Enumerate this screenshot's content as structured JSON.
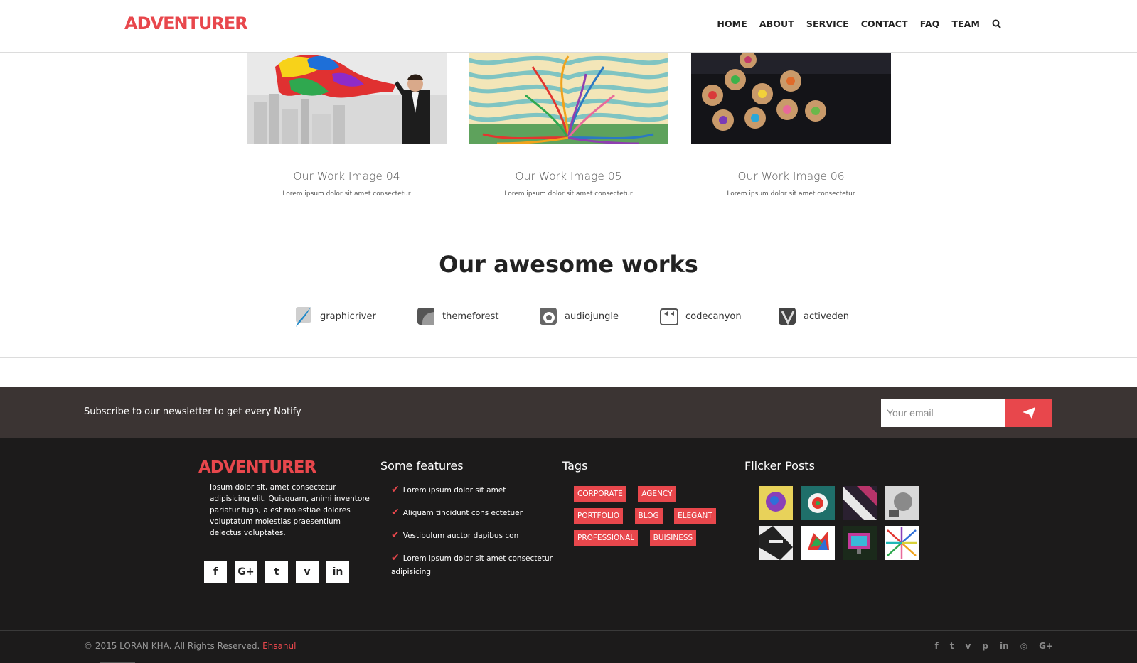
{
  "header": {
    "logo": "ADVENTURER",
    "nav": [
      "HOME",
      "ABOUT",
      "SERVICE",
      "CONTACT",
      "FAQ",
      "TEAM"
    ],
    "search_icon": "search-icon"
  },
  "works": [
    {
      "title": "Our Work Image 04",
      "desc": "Lorem ipsum dolor sit amet consectetur"
    },
    {
      "title": "Our Work Image 05",
      "desc": "Lorem ipsum dolor sit amet consectetur"
    },
    {
      "title": "Our Work Image 06",
      "desc": "Lorem ipsum dolor sit amet consectetur"
    }
  ],
  "awesome": {
    "title": "Our awesome works",
    "markets": [
      {
        "label": "graphicriver",
        "icon": "graphicriver-icon"
      },
      {
        "label": "themeforest",
        "icon": "themeforest-icon"
      },
      {
        "label": "audiojungle",
        "icon": "audiojungle-icon"
      },
      {
        "label": "codecanyon",
        "icon": "codecanyon-icon"
      },
      {
        "label": "activeden",
        "icon": "activeden-icon"
      }
    ]
  },
  "newsletter": {
    "text": "Subscribe to our newsletter to get every Notify",
    "placeholder": "Your email",
    "button_icon": "paper-plane-icon"
  },
  "footer": {
    "logo": "ADVENTURER",
    "about": "Ipsum dolor sit, amet consectetur adipisicing elit. Quisquam, animi inventore pariatur fuga, a est molestiae dolores voluptatum molestias praesentium delectus voluptates.",
    "socials": [
      "f",
      "G+",
      "t",
      "v",
      "in"
    ],
    "features_title": "Some features",
    "features": [
      "Lorem ipsum dolor sit amet",
      "Aliquam tincidunt cons ectetuer",
      "Vestibulum auctor dapibus con",
      "Lorem ipsum dolor sit amet consectetur adipisicing"
    ],
    "tags_title": "Tags",
    "tags": [
      "CORPORATE",
      "AGENCY",
      "PORTFOLIO",
      "BLOG",
      "ELEGANT",
      "PROFESSIONAL",
      "BUISINESS"
    ],
    "flickr_title": "Flicker Posts"
  },
  "bottom": {
    "copyright": "© 2015 LORAN KHA. All Rights Reserved.",
    "author": "Ehsanul",
    "socials": [
      "f",
      "t",
      "v",
      "p",
      "in",
      "◎",
      "G+"
    ]
  },
  "colors": {
    "accent": "#e8474c",
    "newsletter_bg": "#3b3433",
    "footer_bg": "#1c1b1b"
  }
}
